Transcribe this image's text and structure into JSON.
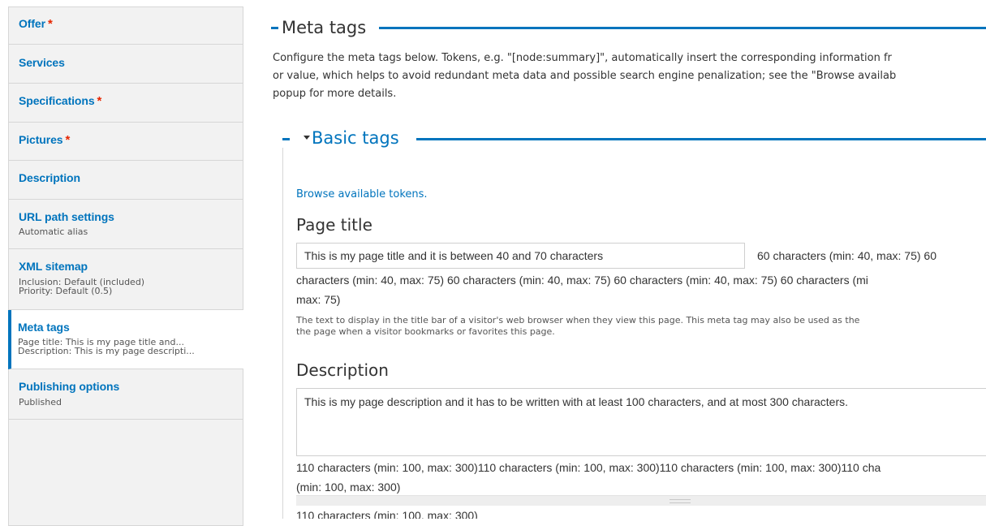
{
  "sidebar": {
    "items": [
      {
        "title": "Offer",
        "required": "*",
        "summary": []
      },
      {
        "title": "Services",
        "required": "",
        "summary": []
      },
      {
        "title": "Specifications",
        "required": "*",
        "summary": []
      },
      {
        "title": "Pictures",
        "required": "*",
        "summary": []
      },
      {
        "title": "Description",
        "required": "",
        "summary": []
      },
      {
        "title": "URL path settings",
        "required": "",
        "summary": [
          "Automatic alias"
        ]
      },
      {
        "title": "XML sitemap",
        "required": "",
        "summary": [
          "Inclusion: Default (included)",
          "Priority: Default (0.5)"
        ]
      },
      {
        "title": "Meta tags",
        "required": "",
        "summary": [
          "Page title: This is my page title and...",
          "Description: This is my page descripti..."
        ]
      },
      {
        "title": "Publishing options",
        "required": "",
        "summary": [
          "Published"
        ]
      }
    ],
    "active_index": 7
  },
  "meta": {
    "title": "Meta tags",
    "description_lines": [
      "Configure the meta tags below. Tokens, e.g. \"[node:summary]\", automatically insert the corresponding information fr",
      "or value, which helps to avoid redundant meta data and possible search engine penalization; see the \"Browse availab",
      "popup for more details."
    ]
  },
  "basic": {
    "title": "Basic tags",
    "browse_link": "Browse available tokens.",
    "page_title": {
      "label": "Page title",
      "value": "This is my page title and it is between 40 and 70 characters",
      "counter_inline": "60 characters (min: 40, max: 75)   60",
      "counter_line2": "characters (min: 40, max: 75)   60 characters (min: 40, max: 75)   60 characters (min: 40, max: 75)   60 characters (mi",
      "counter_line3": "max: 75)",
      "help_lines": [
        "The text to display in the title bar of a visitor's web browser when they view this page. This meta tag may also be used as the",
        "the page when a visitor bookmarks or favorites this page."
      ]
    },
    "description": {
      "label": "Description",
      "value": "This is my page description and it has to be written with at least 100 characters, and at most 300 characters.",
      "counter_line1": "110 characters (min: 100, max: 300)110 characters (min: 100, max: 300)110 characters (min: 100, max: 300)110 cha",
      "counter_line2": "(min: 100, max: 300)",
      "counter_line3": "110 characters (min: 100, max: 300)"
    }
  },
  "colors": {
    "accent": "#0074bd",
    "required": "#e62600",
    "sidebar_bg": "#f2f2f2"
  }
}
